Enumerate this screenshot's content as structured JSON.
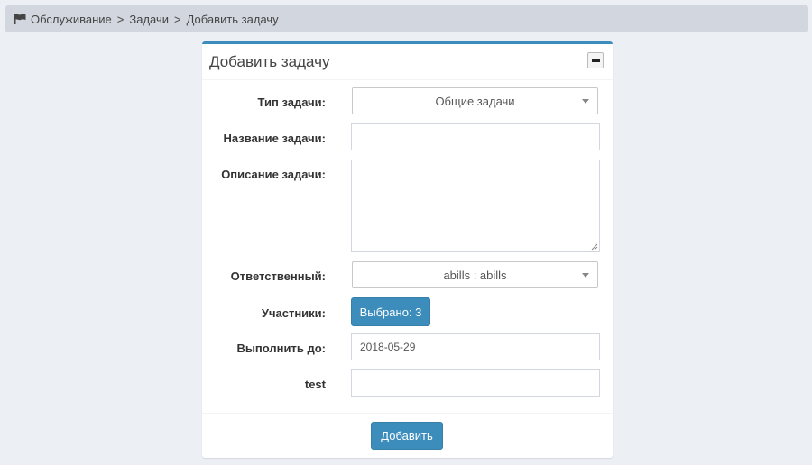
{
  "breadcrumb": {
    "items": [
      "Обслуживание",
      "Задачи",
      "Добавить задачу"
    ],
    "separator": ">"
  },
  "box": {
    "title": "Добавить задачу",
    "collapse_icon": "minus-icon"
  },
  "form": {
    "task_type": {
      "label": "Тип задачи:",
      "value": "Общие задачи"
    },
    "task_name": {
      "label": "Название задачи:",
      "value": ""
    },
    "task_description": {
      "label": "Описание задачи:",
      "value": ""
    },
    "responsible": {
      "label": "Ответственный:",
      "value": "abills : abills"
    },
    "participants": {
      "label": "Участники:",
      "button_label": "Выбрано: 3"
    },
    "due_date": {
      "label": "Выполнить до:",
      "value": "2018-05-29"
    },
    "test": {
      "label": "test",
      "value": ""
    }
  },
  "footer": {
    "submit_label": "Добавить"
  },
  "colors": {
    "primary": "#3c8dbc",
    "page_bg": "#ecf0f5",
    "breadcrumb_bg": "#d2d6de"
  }
}
